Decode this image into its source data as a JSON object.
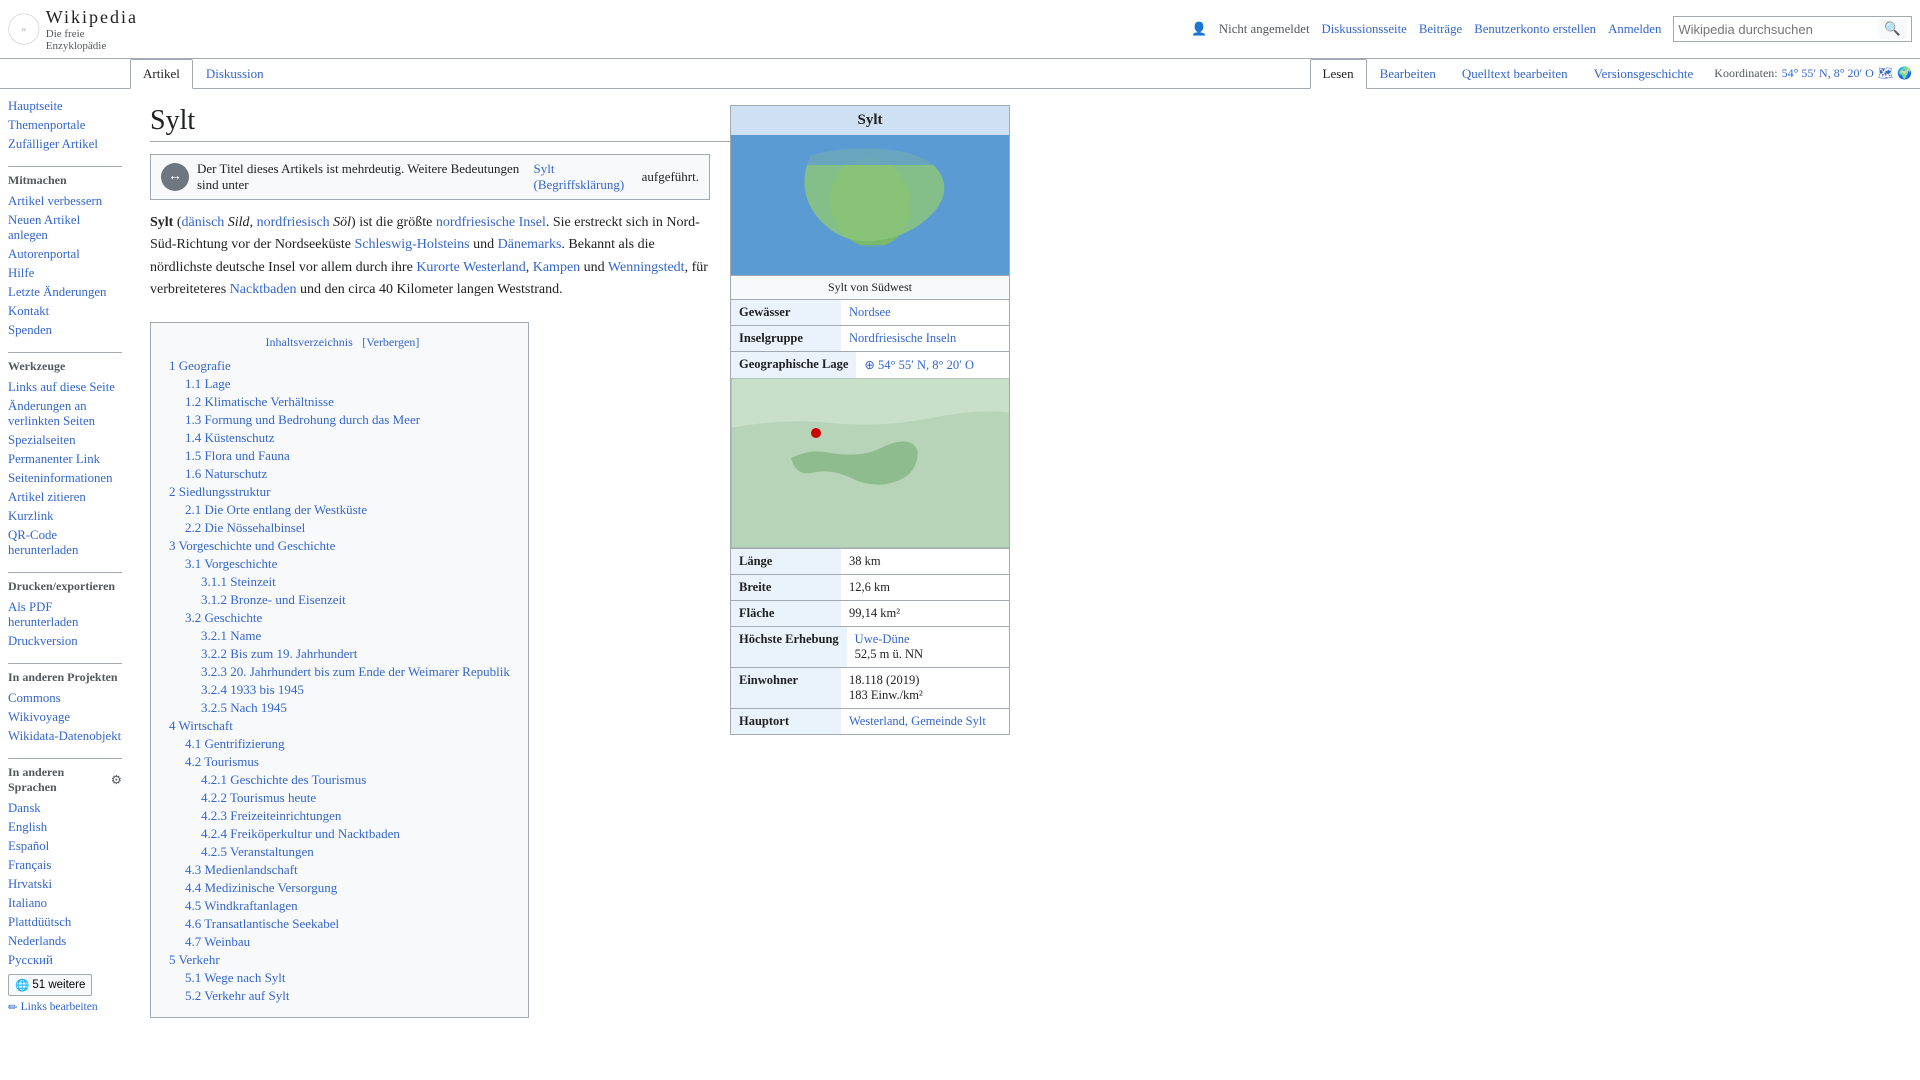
{
  "header": {
    "logo_wiki": "Wikipedia",
    "logo_sub": "Die freie Enzyklopädie",
    "user_icon": "👤",
    "not_logged": "Nicht angemeldet",
    "discussion": "Diskussionsseite",
    "contributions": "Beiträge",
    "create_account": "Benutzerkonto erstellen",
    "login": "Anmelden",
    "search_placeholder": "Wikipedia durchsuchen",
    "search_btn": "🔍"
  },
  "tabs": {
    "artikel": "Artikel",
    "diskussion": "Diskussion",
    "lesen": "Lesen",
    "bearbeiten": "Bearbeiten",
    "quelltext": "Quelltext bearbeiten",
    "versionsgeschichte": "Versionsgeschichte",
    "coords": "Koordinaten:",
    "coords_value": "54° 55′ N, 8° 20′ O"
  },
  "sidebar": {
    "hauptseite": "Hauptseite",
    "themenportale": "Themenportale",
    "zufaelliger": "Zufälliger Artikel",
    "mitmachen_title": "Mitmachen",
    "artikel_verbessern": "Artikel verbessern",
    "neuen_artikel": "Neuen Artikel anlegen",
    "autorenportal": "Autorenportal",
    "hilfe": "Hilfe",
    "letzte_aenderungen": "Letzte Änderungen",
    "kontakt": "Kontakt",
    "spenden": "Spenden",
    "werkzeuge_title": "Werkzeuge",
    "links_auf": "Links auf diese Seite",
    "aenderungen": "Änderungen an verlinkten Seiten",
    "spezialseiten": "Spezialseiten",
    "permanenter": "Permanenter Link",
    "seiteninformationen": "Seiteninformationen",
    "artikel_zitieren": "Artikel zitieren",
    "kurzlink": "Kurzlink",
    "qr_code": "QR-Code herunterladen",
    "drucken_title": "Drucken/exportieren",
    "als_pdf": "Als PDF herunterladen",
    "druckversion": "Druckversion",
    "andere_projekte_title": "In anderen Projekten",
    "commons": "Commons",
    "wikivoyage": "Wikivoyage",
    "wikidata": "Wikidata-Datenobjekt",
    "andere_sprachen_title": "In anderen Sprachen",
    "gear": "⚙",
    "dansk": "Dansk",
    "english": "English",
    "espanol": "Español",
    "francais": "Français",
    "hrvatski": "Hrvatski",
    "italiano": "Italiano",
    "plattdeutsch": "Plattdüütsch",
    "nederlands": "Nederlands",
    "russisch": "Русский",
    "weitere": "51 weitere",
    "links_bearbeiten": "Links bearbeiten"
  },
  "page": {
    "title": "Sylt",
    "disambig_text": "Der Titel dieses Artikels ist mehrdeutig. Weitere Bedeutungen sind unter",
    "disambig_link": "Sylt (Begriffsklärung)",
    "disambig_suffix": "aufgeführt.",
    "intro": "Sylt (dänisch Sild, nordfriesisch Söl) ist die größte nordfriesische Insel. Sie erstreckt sich in Nord-Süd-Richtung vor der Nordseeküste Schleswig-Holsteins und Dänemarks. Bekannt als die nördlichste deutsche Insel vor allem durch ihre Kurorte Westerland, Kampen und Wenningstedt, für verbreiteteres Nacktbaden und den circa 40 Kilometer langen Weststrand."
  },
  "toc": {
    "title": "Inhaltsverzeichnis",
    "verbergen": "[Verbergen]",
    "items": [
      {
        "num": "1",
        "text": "Geografie"
      },
      {
        "num": "1.1",
        "text": "Lage",
        "sub": 1
      },
      {
        "num": "1.2",
        "text": "Klimatische Verhältnisse",
        "sub": 1
      },
      {
        "num": "1.3",
        "text": "Formung und Bedrohung durch das Meer",
        "sub": 1
      },
      {
        "num": "1.4",
        "text": "Küstenschutz",
        "sub": 1
      },
      {
        "num": "1.5",
        "text": "Flora und Fauna",
        "sub": 1
      },
      {
        "num": "1.6",
        "text": "Naturschutz",
        "sub": 1
      },
      {
        "num": "2",
        "text": "Siedlungsstruktur"
      },
      {
        "num": "2.1",
        "text": "Die Orte entlang der Westküste",
        "sub": 1
      },
      {
        "num": "2.2",
        "text": "Die Nössehalbinsel",
        "sub": 1
      },
      {
        "num": "3",
        "text": "Vorgeschichte und Geschichte"
      },
      {
        "num": "3.1",
        "text": "Vorgeschichte",
        "sub": 1
      },
      {
        "num": "3.1.1",
        "text": "Steinzeit",
        "sub": 2
      },
      {
        "num": "3.1.2",
        "text": "Bronze- und Eisenzeit",
        "sub": 2
      },
      {
        "num": "3.2",
        "text": "Geschichte",
        "sub": 1
      },
      {
        "num": "3.2.1",
        "text": "Name",
        "sub": 2
      },
      {
        "num": "3.2.2",
        "text": "Bis zum 19. Jahrhundert",
        "sub": 2
      },
      {
        "num": "3.2.3",
        "text": "20. Jahrhundert bis zum Ende der Weimarer Republik",
        "sub": 2
      },
      {
        "num": "3.2.4",
        "text": "1933 bis 1945",
        "sub": 2
      },
      {
        "num": "3.2.5",
        "text": "Nach 1945",
        "sub": 2
      },
      {
        "num": "4",
        "text": "Wirtschaft"
      },
      {
        "num": "4.1",
        "text": "Gentrifizierung",
        "sub": 1
      },
      {
        "num": "4.2",
        "text": "Tourismus",
        "sub": 1
      },
      {
        "num": "4.2.1",
        "text": "Geschichte des Tourismus",
        "sub": 2
      },
      {
        "num": "4.2.2",
        "text": "Tourismus heute",
        "sub": 2
      },
      {
        "num": "4.2.3",
        "text": "Freizeiteinrichtungen",
        "sub": 2
      },
      {
        "num": "4.2.4",
        "text": "Freiköperkultur und Nacktbaden",
        "sub": 2
      },
      {
        "num": "4.2.5",
        "text": "Veranstaltungen",
        "sub": 2
      },
      {
        "num": "4.3",
        "text": "Medienlandschaft",
        "sub": 1
      },
      {
        "num": "4.4",
        "text": "Medizinische Versorgung",
        "sub": 1
      },
      {
        "num": "4.5",
        "text": "Windkraftanlagen",
        "sub": 1
      },
      {
        "num": "4.6",
        "text": "Transatlantische Seekabel",
        "sub": 1
      },
      {
        "num": "4.7",
        "text": "Weinbau",
        "sub": 1
      },
      {
        "num": "5",
        "text": "Verkehr"
      },
      {
        "num": "5.1",
        "text": "Wege nach Sylt",
        "sub": 1
      },
      {
        "num": "5.2",
        "text": "Verkehr auf Sylt",
        "sub": 1
      }
    ]
  },
  "infobox": {
    "title": "Sylt",
    "caption": "Sylt von Südwest",
    "rows": [
      {
        "label": "Gewässer",
        "value": "Nordsee",
        "link": true
      },
      {
        "label": "Inselgruppe",
        "value": "Nordfriesische Inseln",
        "link": true
      },
      {
        "label": "Geographische Lage",
        "value": "⊕ 54° 55′ N, 8° 20′ O",
        "link": false
      },
      {
        "label": "Länge",
        "value": "38 km",
        "link": false
      },
      {
        "label": "Breite",
        "value": "12,6 km",
        "link": false
      },
      {
        "label": "Fläche",
        "value": "99,14 km²",
        "link": false
      },
      {
        "label": "Höchste Erhebung",
        "value": "Uwe-Düne\n52,5 m ü. NN",
        "link": true
      },
      {
        "label": "Einwohner",
        "value": "18.118 (2019)\n183 Einw./km²",
        "link": false
      },
      {
        "label": "Hauptort",
        "value": "Westerland, Gemeinde Sylt",
        "link": true
      }
    ]
  }
}
